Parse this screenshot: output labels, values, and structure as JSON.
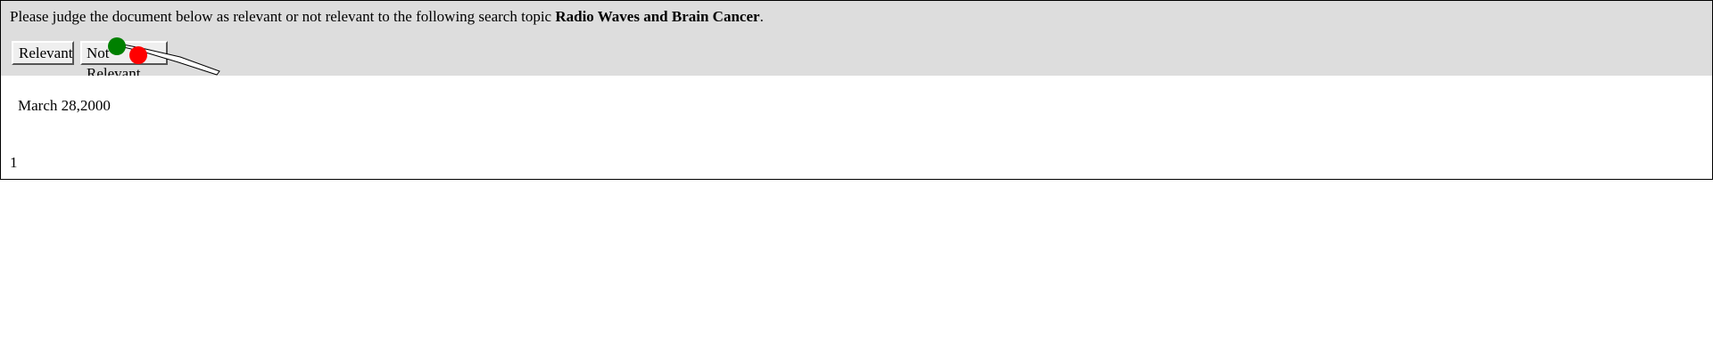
{
  "header": {
    "instruction_prefix": "Please judge the document below as relevant or not relevant to the following search topic",
    "topic": "Radio Waves and Brain Cancer",
    "instruction_suffix": "."
  },
  "buttons": {
    "relevant_label": "Relevant",
    "not_relevant_label": "Not Relevant"
  },
  "document": {
    "date": "March 28,2000",
    "page_number": "1"
  },
  "cursor_markers": {
    "start_color": "#008000",
    "end_color": "#ff0000"
  },
  "colors": {
    "panel_background": "#dddddd",
    "button_background": "#efefef"
  }
}
